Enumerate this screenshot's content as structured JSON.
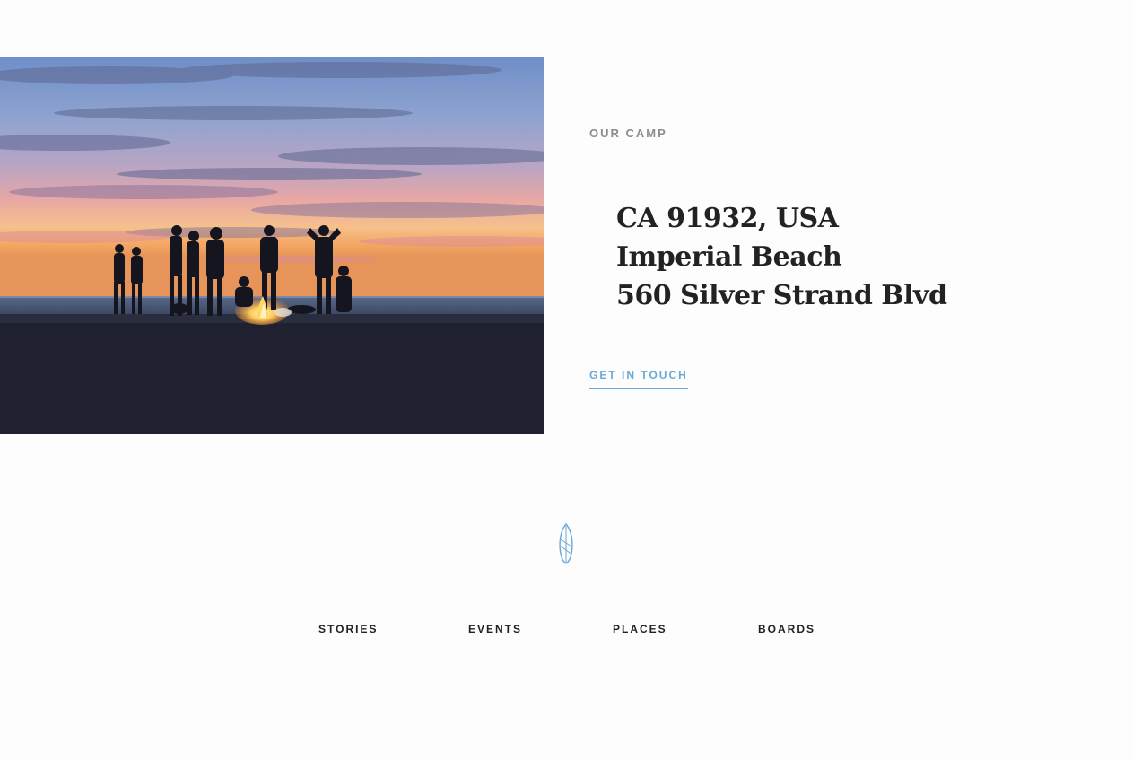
{
  "hero": {
    "image_alt": "Silhouettes of friends around a bonfire on the beach at sunset"
  },
  "camp": {
    "eyebrow": "OUR CAMP",
    "address_lines": [
      "CA 91932, USA",
      "Imperial Beach",
      "560 Silver Strand Blvd"
    ],
    "cta_label": "GET IN TOUCH"
  },
  "divider_icon": "surfboard-icon",
  "footer_nav": {
    "items": [
      "STORIES",
      "EVENTS",
      "PLACES",
      "BOARDS"
    ]
  },
  "colors": {
    "accent": "#6aa8d8",
    "heading": "#222222",
    "eyebrow": "#8c8c8c",
    "background": "#fdfdfd"
  }
}
